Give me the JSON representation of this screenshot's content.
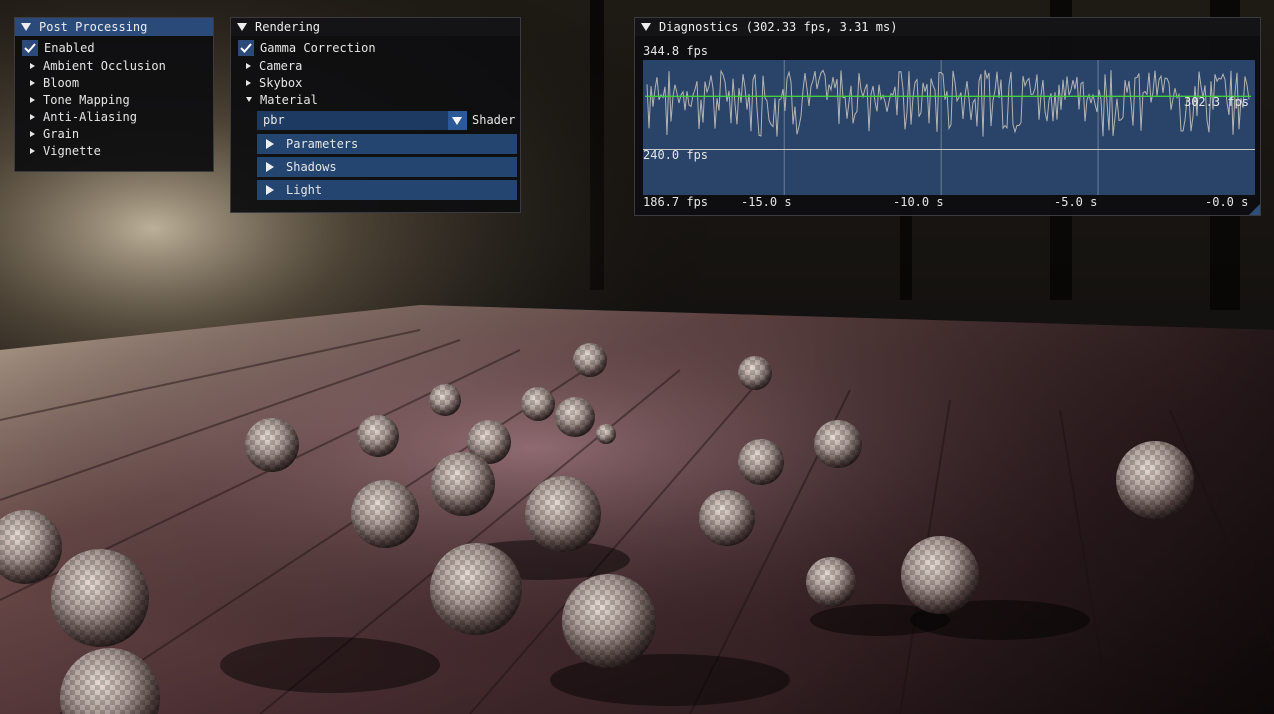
{
  "post_processing": {
    "title": "Post Processing",
    "enabled_label": "Enabled",
    "enabled": true,
    "items": [
      {
        "label": "Ambient Occlusion"
      },
      {
        "label": "Bloom"
      },
      {
        "label": "Tone Mapping"
      },
      {
        "label": "Anti-Aliasing"
      },
      {
        "label": "Grain"
      },
      {
        "label": "Vignette"
      }
    ]
  },
  "rendering": {
    "title": "Rendering",
    "gamma_label": "Gamma Correction",
    "gamma_enabled": true,
    "items": [
      {
        "label": "Camera"
      },
      {
        "label": "Skybox"
      },
      {
        "label": "Material"
      }
    ],
    "shader_value": "pbr",
    "shader_label": "Shader",
    "headers": [
      {
        "label": "Parameters"
      },
      {
        "label": "Shadows"
      },
      {
        "label": "Light"
      }
    ]
  },
  "diagnostics": {
    "title": "Diagnostics (302.33 fps, 3.31 ms)",
    "max_label": "344.8 fps",
    "current_label": "302.3 fps",
    "threshold_label": "240.0 fps",
    "min_label": "186.7 fps",
    "time_ticks": [
      "-15.0 s",
      "-10.0 s",
      "-5.0 s",
      "-0.0 s"
    ],
    "plot_colors": {
      "trace": "#b4b4b4",
      "average": "#3fd23f",
      "background": "#2a4368"
    }
  },
  "colors": {
    "accent": "#2c4a78",
    "title_active": "#2a4a7a",
    "header": "#24456f"
  }
}
